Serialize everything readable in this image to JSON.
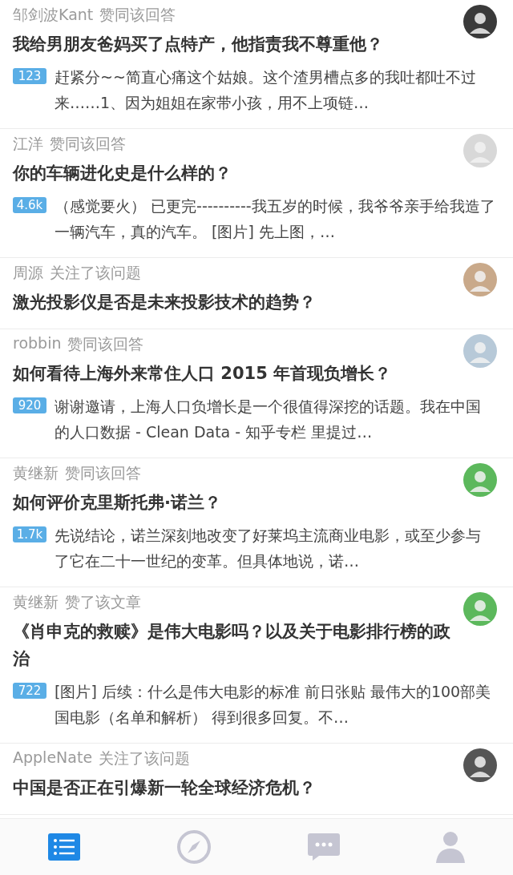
{
  "feed": [
    {
      "actor": "邹剑波Kant",
      "action": "赞同该回答",
      "avatar": {
        "color": "#3a3a3a"
      },
      "title": "我给男朋友爸妈买了点特产，他指责我不尊重他？",
      "votes": "123",
      "excerpt": "赶紧分~~简直心痛这个姑娘。这个渣男槽点多的我吐都吐不过来……1、因为姐姐在家带小孩，用不上项链…"
    },
    {
      "actor": "江洋",
      "action": "赞同该回答",
      "avatar": {
        "color": "#d8d8d8"
      },
      "title": "你的车辆进化史是什么样的？",
      "votes": "4.6k",
      "excerpt": "（感觉要火） 已更完----------我五岁的时候，我爷爷亲手给我造了一辆汽车，真的汽车。 [图片] 先上图，…"
    },
    {
      "actor": "周源",
      "action": "关注了该问题",
      "avatar": {
        "color": "#c9a98a"
      },
      "title": "激光投影仪是否是未来投影技术的趋势？"
    },
    {
      "actor": "robbin",
      "action": "赞同该回答",
      "avatar": {
        "color": "#b7c9d8"
      },
      "title": "如何看待上海外来常住人口 2015 年首现负增长？",
      "votes": "920",
      "excerpt": "谢谢邀请，上海人口负增长是一个很值得深挖的话题。我在中国的人口数据 - Clean Data - 知乎专栏 里提过…"
    },
    {
      "actor": "黄继新",
      "action": "赞同该回答",
      "avatar": {
        "color": "#5cb85c"
      },
      "title": "如何评价克里斯托弗·诺兰？",
      "votes": "1.7k",
      "excerpt": "先说结论，诺兰深刻地改变了好莱坞主流商业电影，或至少参与了它在二十一世纪的变革。但具体地说，诺…"
    },
    {
      "actor": "黄继新",
      "action": "赞了该文章",
      "avatar": {
        "color": "#5cb85c"
      },
      "title": "《肖申克的救赎》是伟大电影吗？以及关于电影排行榜的政治",
      "votes": "722",
      "excerpt": "[图片] 后续：什么是伟大电影的标准 前日张贴 最伟大的100部美国电影（名单和解析） 得到很多回复。不…"
    },
    {
      "actor": "AppleNate",
      "action": "关注了该问题",
      "avatar": {
        "color": "#555555"
      },
      "title": "中国是否正在引爆新一轮全球经济危机？"
    }
  ],
  "tabs": [
    {
      "kind": "feed",
      "selected": true
    },
    {
      "kind": "explore",
      "selected": false
    },
    {
      "kind": "messages",
      "selected": false
    },
    {
      "kind": "profile",
      "selected": false
    }
  ]
}
